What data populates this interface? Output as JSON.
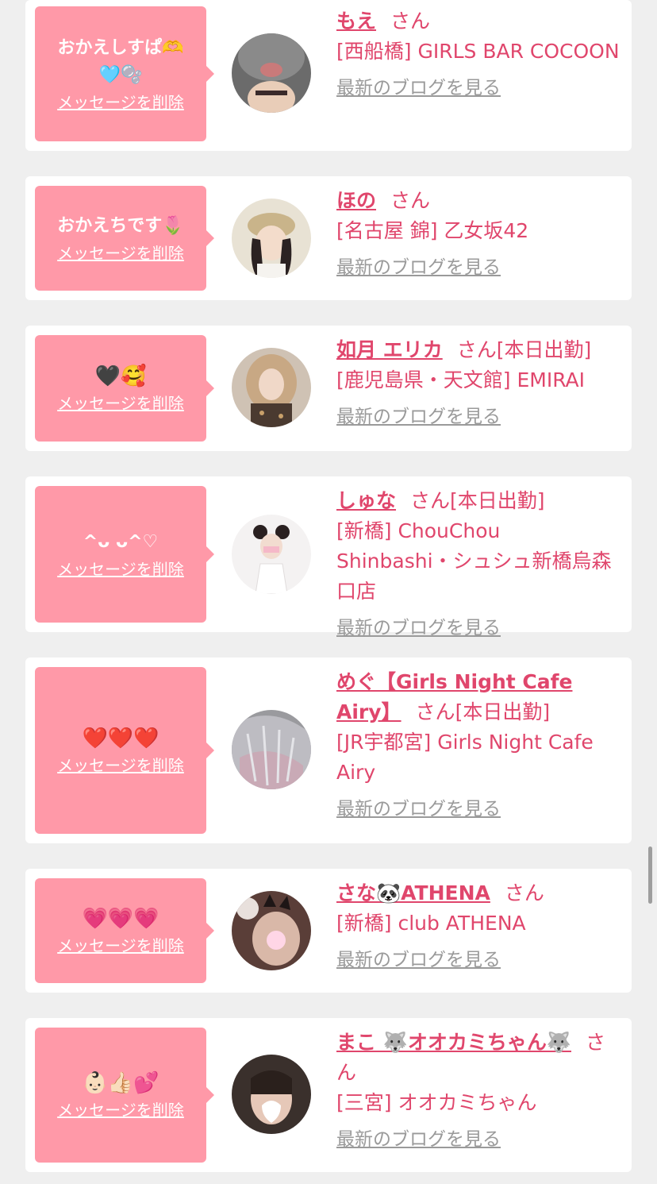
{
  "delete_label": "メッセージを削除",
  "blog_label": "最新のブログを見る",
  "san_label": "さん",
  "cards": [
    {
      "message": "おかえしすぱ🫶\n🩵🫧",
      "name": "もえ",
      "status": "",
      "shop": "[西船橋] GIRLS BAR COCOON",
      "avatar": "rabbit-hat-avatar"
    },
    {
      "message": "おかえちです🌷",
      "name": "ほの",
      "status": "",
      "shop": "[名古屋 錦] 乙女坂42",
      "avatar": "beret-girl-avatar"
    },
    {
      "message": "🖤🥰",
      "name": "如月 エリカ",
      "status": "[本日出勤]",
      "shop": "[鹿児島県・天文館] EMIRAI",
      "avatar": "blonde-girl-avatar"
    },
    {
      "message": "^ᴗ ᴗ^♡",
      "name": "しゅな",
      "status": "[本日出勤]",
      "shop": "[新橋] ChouChou Shinbashi・シュシュ新橋烏森口店",
      "avatar": "white-outfit-girl-avatar"
    },
    {
      "message": "❤️❤️❤️",
      "name": "めぐ【Girls Night Cafe Airy】",
      "status": "[本日出勤]",
      "shop": "[JR宇都宮] Girls Night Cafe Airy",
      "avatar": "gray-hair-avatar"
    },
    {
      "message": "💗💗💗",
      "name": "さな🐼ATHENA",
      "status": "",
      "shop": "[新橋] club ATHENA",
      "avatar": "cat-ear-girl-avatar"
    },
    {
      "message": "👶🏻👍🏻💕",
      "name": "まこ 🐺オオカミちゃん🐺",
      "status": "",
      "shop": "[三宮] オオカミちゃん",
      "avatar": "hidden-face-avatar"
    }
  ]
}
